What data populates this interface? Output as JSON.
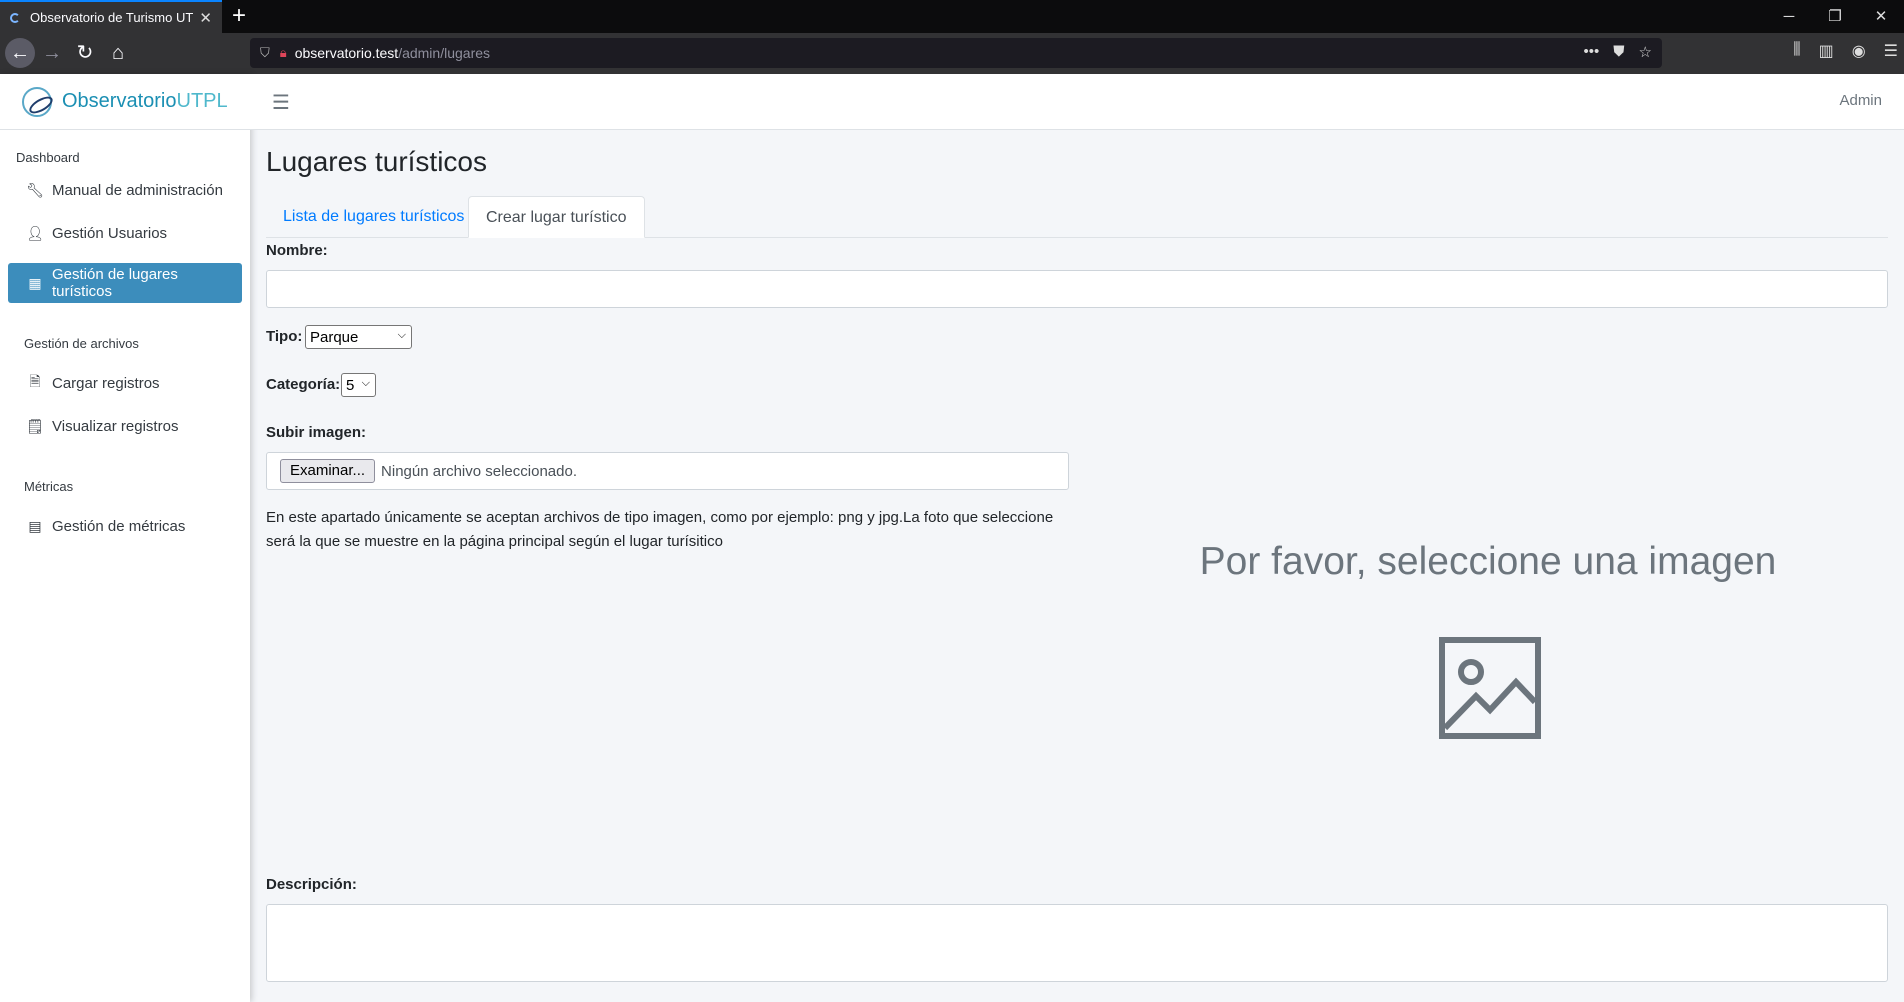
{
  "browser": {
    "tab_title": "Observatorio de Turismo UTPL",
    "tab_close": "✕",
    "new_tab": "+",
    "url_host": "observatorio.test",
    "url_path": "/admin/lugares"
  },
  "brand": {
    "name_strong": "Observatorio",
    "name_light": "UTPL"
  },
  "topnav": {
    "user": "Admin"
  },
  "sidebar": {
    "sections": [
      {
        "header": "Dashboard"
      },
      {
        "header": "Gestión de archivos"
      },
      {
        "header": "Métricas"
      }
    ],
    "items": [
      {
        "label": "Manual de administración",
        "icon": "wrench-icon"
      },
      {
        "label": "Gestión Usuarios",
        "icon": "user-icon"
      },
      {
        "label": "Gestión de lugares turísticos",
        "icon": "building-icon",
        "active": true
      },
      {
        "label": "Cargar registros",
        "icon": "file-import-icon"
      },
      {
        "label": "Visualizar registros",
        "icon": "file-text-icon"
      },
      {
        "label": "Gestión de métricas",
        "icon": "calculator-icon"
      }
    ]
  },
  "page": {
    "title": "Lugares turísticos",
    "tabs": [
      {
        "label": "Lista de lugares turísticos",
        "active": false
      },
      {
        "label": "Crear lugar turístico",
        "active": true
      }
    ]
  },
  "form": {
    "nombre_label": "Nombre:",
    "nombre_value": "",
    "tipo_label": "Tipo:",
    "tipo_value": "Parque",
    "categoria_label": "Categoría:",
    "categoria_value": "5",
    "imagen_label": "Subir imagen:",
    "file_button": "Examinar...",
    "file_status": "Ningún archivo seleccionado.",
    "help_text": "En este apartado únicamente se aceptan archivos de tipo imagen, como por ejemplo: png y jpg.La foto que seleccione será la que se muestre en la página principal según el lugar turísitico",
    "descripcion_label": "Descripción:",
    "descripcion_value": ""
  },
  "preview": {
    "text": "Por favor, seleccione una imagen",
    "icon": "image-placeholder-icon"
  },
  "colors": {
    "sidebar_active": "#3c8dbc",
    "link": "#007bff",
    "brand": "#17a2b8",
    "placeholder_gray": "#6c757d"
  }
}
